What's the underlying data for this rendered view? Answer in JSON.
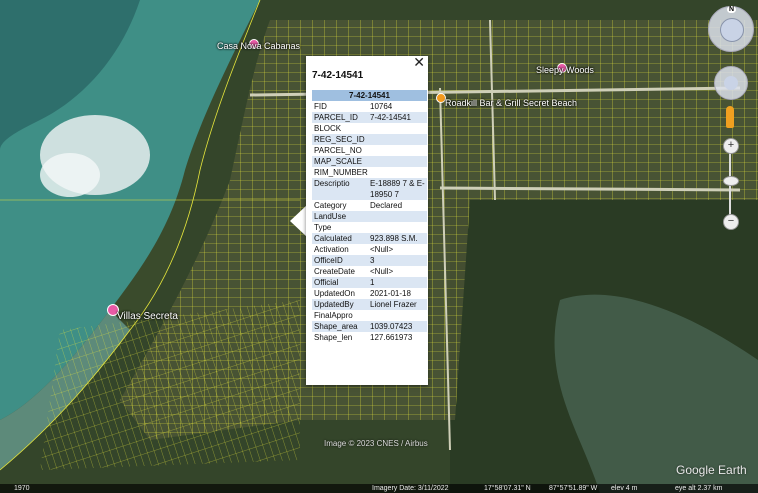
{
  "places": {
    "casa_nova": "Casa Nova Cabanas",
    "sleepy_woods": "Sleepy Woods",
    "roadkill": "Roadkill Bar & Grill Secret Beach",
    "villas": "Villas Secreta"
  },
  "popup": {
    "close": "✕",
    "title": "7-42-14541",
    "table_header": "7-42-14541",
    "rows": [
      {
        "k": "FID",
        "v": "10764"
      },
      {
        "k": "PARCEL_ID",
        "v": "7-42-14541"
      },
      {
        "k": "BLOCK",
        "v": ""
      },
      {
        "k": "REG_SEC_ID",
        "v": ""
      },
      {
        "k": "PARCEL_NO",
        "v": ""
      },
      {
        "k": "MAP_SCALE",
        "v": ""
      },
      {
        "k": "RIM_NUMBER",
        "v": ""
      },
      {
        "k": "Descriptio",
        "v": "E-18889 7 & E-18950 7"
      },
      {
        "k": "Category",
        "v": "Declared"
      },
      {
        "k": "LandUse",
        "v": ""
      },
      {
        "k": "Type",
        "v": ""
      },
      {
        "k": "Calculated",
        "v": "923.898 S.M."
      },
      {
        "k": "Activation",
        "v": "<Null>"
      },
      {
        "k": "OfficeID",
        "v": "3"
      },
      {
        "k": "CreateDate",
        "v": "<Null>"
      },
      {
        "k": "Official",
        "v": "1"
      },
      {
        "k": "UpdatedOn",
        "v": "2021-01-18"
      },
      {
        "k": "UpdatedBy",
        "v": "Lionel Frazer"
      },
      {
        "k": "FinalAppro",
        "v": ""
      },
      {
        "k": "Shape_area",
        "v": "1039.07423"
      },
      {
        "k": "Shape_len",
        "v": "127.661973"
      }
    ]
  },
  "nav": {
    "north": "N",
    "zoom_in": "+",
    "zoom_out": "−"
  },
  "credit": "Image © 2023 CNES / Airbus",
  "watermark": "Google Earth",
  "footer": {
    "year": "1970",
    "imagery": "Imagery Date: 3/11/2022",
    "lat": "17°58'07.31\" N",
    "lon": "87°57'51.89\" W",
    "elev": "elev    4 m",
    "eye": "eye alt  2.37 km"
  },
  "colors": {
    "parcel_line": "#e6e63c",
    "popup_header": "#9fbfe0",
    "popup_stripe": "#dbe6f3"
  },
  "icons": [
    "compass-icon",
    "look-control-icon",
    "move-control-icon",
    "pegman-icon",
    "place-pin-icon"
  ]
}
